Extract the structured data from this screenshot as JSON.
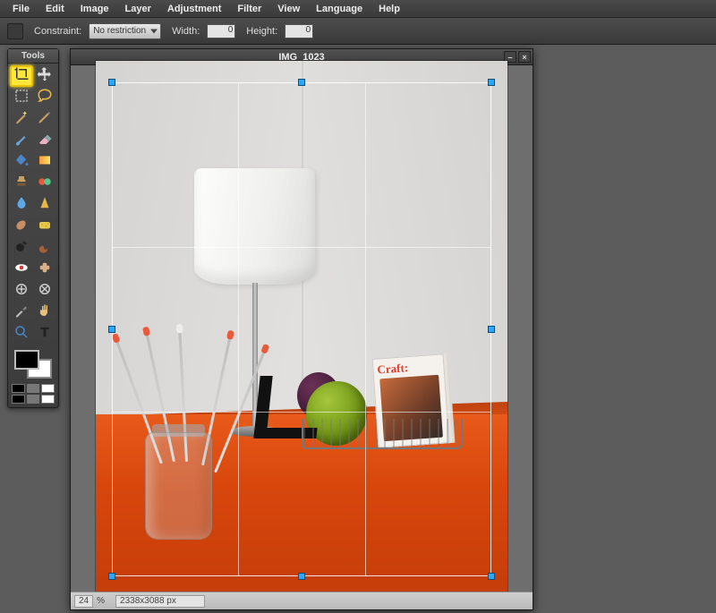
{
  "menu": [
    "File",
    "Edit",
    "Image",
    "Layer",
    "Adjustment",
    "Filter",
    "View",
    "Language",
    "Help"
  ],
  "options": {
    "constraint_label": "Constraint:",
    "constraint_value": "No restriction",
    "width_label": "Width:",
    "width_value": "0",
    "height_label": "Height:",
    "height_value": "0"
  },
  "tools": {
    "title": "Tools",
    "items": [
      "crop",
      "move",
      "marquee",
      "lasso",
      "wand",
      "pencil",
      "brush",
      "eraser",
      "paint-bucket",
      "gradient",
      "clone-stamp",
      "color-replace",
      "blur",
      "sharpen",
      "smudge",
      "sponge",
      "dodge",
      "burn",
      "red-eye",
      "spot-heal",
      "bloat",
      "pinch",
      "color-picker",
      "hand",
      "zoom",
      "type"
    ],
    "selected": "crop"
  },
  "swatches": {
    "fg": "#000000",
    "bg": "#ffffff"
  },
  "doc": {
    "title": "IMG_1023",
    "zoom": "24",
    "zoom_unit": "%",
    "dimensions": "2338x3088 px",
    "magazine_title": "Craft:"
  },
  "window_controls": {
    "minimize": "–",
    "close": "×"
  }
}
